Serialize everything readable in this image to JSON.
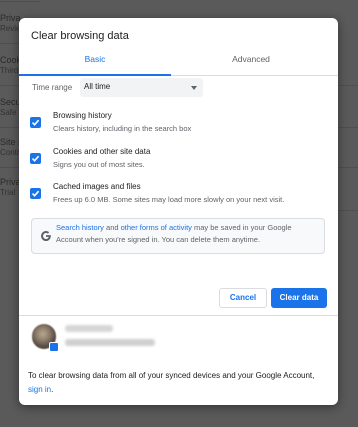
{
  "background": {
    "items": [
      {
        "title": "Priva",
        "sub": "Revie"
      },
      {
        "title": "Cook",
        "sub": "Third"
      },
      {
        "title": "Secu",
        "sub": "Safe"
      },
      {
        "title": "Site s",
        "sub": "Contr"
      },
      {
        "title": "Priva",
        "sub": "Trial"
      }
    ]
  },
  "dialog": {
    "title": "Clear browsing data",
    "tabs": {
      "basic": "Basic",
      "advanced": "Advanced"
    },
    "time_range": {
      "label": "Time range",
      "value": "All time"
    },
    "options": [
      {
        "title": "Browsing history",
        "sub": "Clears history, including in the search box",
        "checked": true
      },
      {
        "title": "Cookies and other site data",
        "sub": "Signs you out of most sites.",
        "checked": true
      },
      {
        "title": "Cached images and files",
        "sub": "Frees up 6.0 MB. Some sites may load more slowly on your next visit.",
        "checked": true
      }
    ],
    "info": {
      "link1": "Search history",
      "and": " and ",
      "link2": "other forms of activity",
      "rest": " may be saved in your Google Account when you're signed in. You can delete them anytime."
    },
    "buttons": {
      "cancel": "Cancel",
      "clear": "Clear data"
    },
    "footer": {
      "text": "To clear browsing data from all of your synced devices and your Google Account, ",
      "link": "sign in",
      "end": "."
    },
    "colors": {
      "accent": "#1a73e8",
      "text": "#202124",
      "muted": "#5f6368"
    }
  }
}
